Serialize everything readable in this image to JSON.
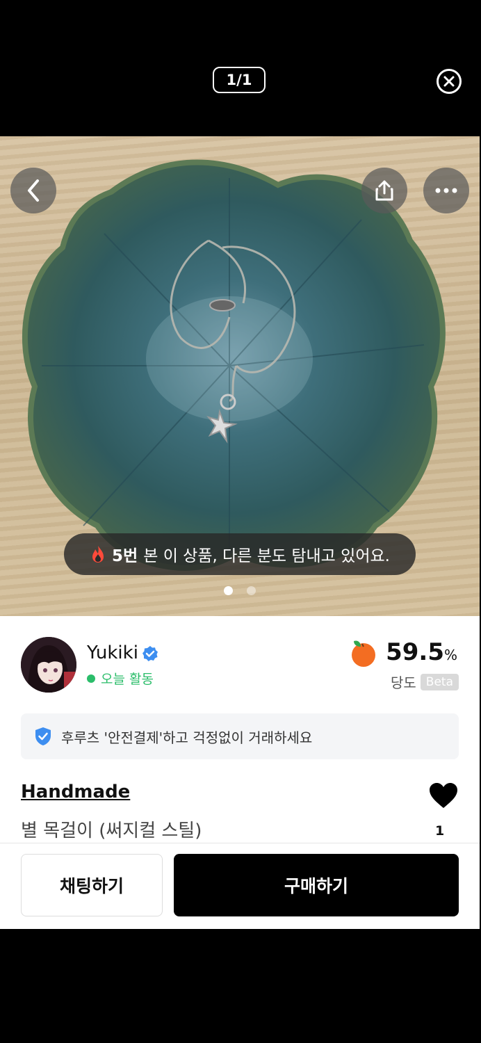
{
  "viewer": {
    "counter": "1/1"
  },
  "photo": {
    "toast_highlight": "5번",
    "toast_text": "본 이 상품, 다른 분도 탐내고 있어요.",
    "page_dots": 2,
    "active_dot": 0
  },
  "seller": {
    "name": "Yukiki",
    "status": "오늘 활동",
    "score_value": "59.5",
    "score_unit": "%",
    "score_label": "당도",
    "beta_label": "Beta"
  },
  "safe_banner": {
    "text": "후루츠 '안전결제'하고 걱정없이 거래하세요"
  },
  "product": {
    "category": "Handmade",
    "title": "별 목걸이 (써지컬 스틸)",
    "like_count": "1"
  },
  "actions": {
    "chat_label": "채팅하기",
    "buy_label": "구매하기"
  },
  "colors": {
    "status_green": "#2bbd6a",
    "verified_blue": "#3d8ef0",
    "peach": "#f36d22"
  }
}
